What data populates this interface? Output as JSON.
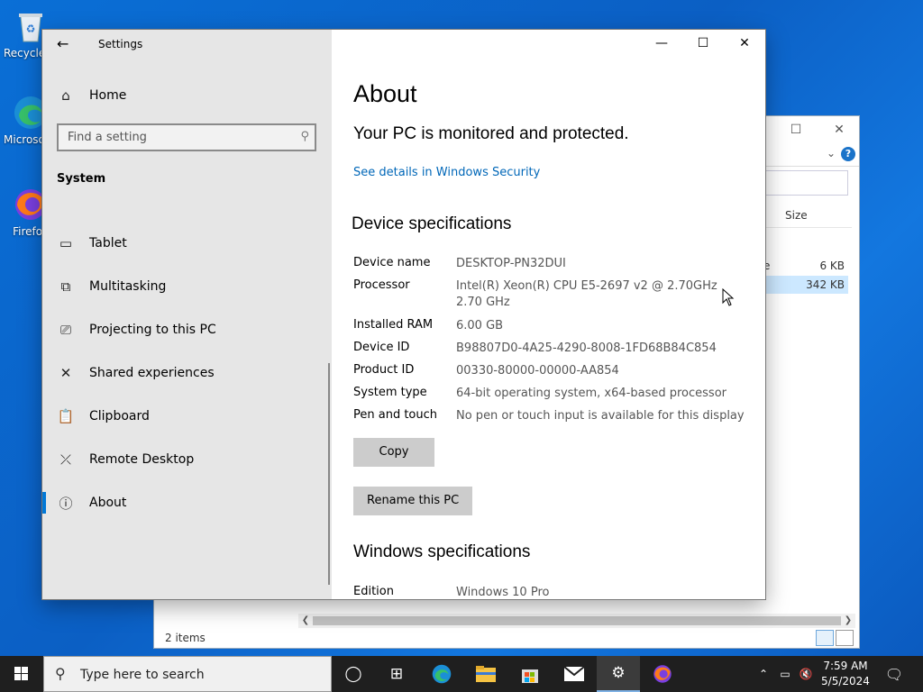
{
  "desktop": {
    "icons": [
      {
        "label": "Recycle Bin",
        "icon": "recycle-bin-icon"
      },
      {
        "label": "Microsoft Edge",
        "icon": "edge-icon"
      },
      {
        "label": "Firefox",
        "icon": "firefox-icon"
      }
    ]
  },
  "explorer": {
    "column_size": "Size",
    "rows": [
      {
        "name": "e",
        "size": "6 KB",
        "selected": false
      },
      {
        "name": "",
        "size": "342 KB",
        "selected": true
      }
    ],
    "status": "2 items"
  },
  "settings": {
    "app_title": "Settings",
    "nav_home": "Home",
    "search_placeholder": "Find a setting",
    "section": "System",
    "nav_items": [
      {
        "label": "Tablet",
        "icon": "tablet-icon"
      },
      {
        "label": "Multitasking",
        "icon": "multitasking-icon"
      },
      {
        "label": "Projecting to this PC",
        "icon": "projecting-icon"
      },
      {
        "label": "Shared experiences",
        "icon": "shared-experiences-icon"
      },
      {
        "label": "Clipboard",
        "icon": "clipboard-icon"
      },
      {
        "label": "Remote Desktop",
        "icon": "remote-desktop-icon"
      },
      {
        "label": "About",
        "icon": "info-icon",
        "selected": true
      }
    ],
    "page_title": "About",
    "protection_status": "Your PC is monitored and protected.",
    "security_link": "See details in Windows Security",
    "device_specs_heading": "Device specifications",
    "specs": [
      {
        "label": "Device name",
        "value": "DESKTOP-PN32DUI"
      },
      {
        "label": "Processor",
        "value": "Intel(R) Xeon(R) CPU E5-2697 v2 @ 2.70GHz   2.70 GHz"
      },
      {
        "label": "Installed RAM",
        "value": "6.00 GB"
      },
      {
        "label": "Device ID",
        "value": "B98807D0-4A25-4290-8008-1FD68B84C854"
      },
      {
        "label": "Product ID",
        "value": "00330-80000-00000-AA854"
      },
      {
        "label": "System type",
        "value": "64-bit operating system, x64-based processor"
      },
      {
        "label": "Pen and touch",
        "value": "No pen or touch input is available for this display"
      }
    ],
    "copy_button": "Copy",
    "rename_button": "Rename this PC",
    "windows_specs_heading": "Windows specifications",
    "win_specs": [
      {
        "label": "Edition",
        "value": "Windows 10 Pro"
      }
    ]
  },
  "taskbar": {
    "search_placeholder": "Type here to search",
    "time": "7:59 AM",
    "date": "5/5/2024",
    "apps": [
      "task-view-icon",
      "edge-icon",
      "file-explorer-icon",
      "store-icon",
      "mail-icon",
      "settings-icon",
      "firefox-icon"
    ]
  },
  "colors": {
    "accent": "#0078d7",
    "link": "#0067b8",
    "sidebar_bg": "#e6e6e6",
    "taskbar_bg": "#1f1f1f"
  }
}
